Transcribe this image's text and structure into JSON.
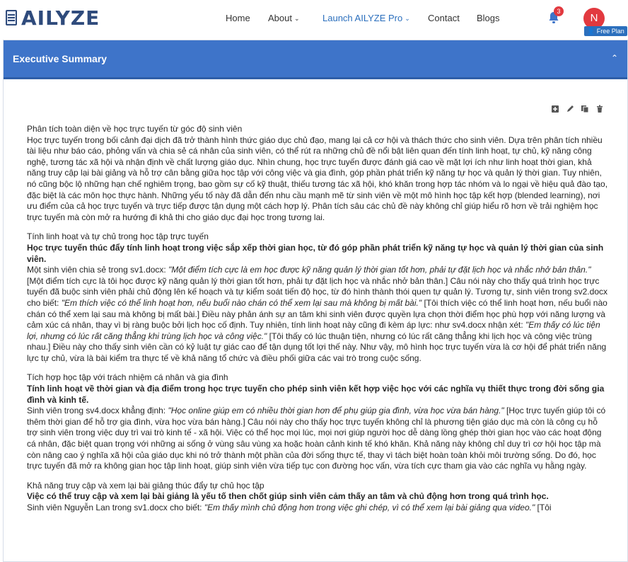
{
  "brand": {
    "name": "AILYZE"
  },
  "nav": {
    "home": "Home",
    "about": "About",
    "launch": "Launch AILYZE Pro",
    "contact": "Contact",
    "blogs": "Blogs"
  },
  "notifications": {
    "count": "3"
  },
  "user": {
    "initial": "N",
    "plan": "Free Plan"
  },
  "panel": {
    "title": "Executive Summary"
  },
  "sections": [
    {
      "heading": "Phân tích toàn diện về học trực tuyến từ góc độ sinh viên",
      "body": "Học trực tuyến trong bối cảnh đại dịch đã trở thành hình thức giáo dục chủ đạo, mang lại cả cơ hội và thách thức cho sinh viên. Dựa trên phân tích nhiều tài liệu như báo cáo, phỏng vấn và chia sẻ cá nhân của sinh viên, có thể rút ra những chủ đề nổi bật liên quan đến tính linh hoạt, tự chủ, kỹ năng công nghệ, tương tác xã hội và nhận định về chất lượng giáo dục. Nhìn chung, học trực tuyến được đánh giá cao về mặt lợi ích như linh hoạt thời gian, khả năng truy cập lại bài giảng và hỗ trợ cân bằng giữa học tập với công việc và gia đình, góp phần phát triển kỹ năng tự học và quản lý thời gian. Tuy nhiên, nó cũng bộc lộ những hạn chế nghiêm trọng, bao gồm sự cố kỹ thuật, thiếu tương tác xã hội, khó khăn trong hợp tác nhóm và lo ngại về hiệu quả đào tạo, đặc biệt là các môn học thực hành. Những yếu tố này đã dẫn đến nhu cầu mạnh mẽ từ sinh viên về một mô hình học tập kết hợp (blended learning), nơi ưu điểm của cả học trực tuyến và trực tiếp được tận dụng một cách hợp lý. Phân tích sâu các chủ đề này không chỉ giúp hiểu rõ hơn về trải nghiệm học trực tuyến mà còn mở ra hướng đi khả thi cho giáo dục đại học trong tương lai."
    },
    {
      "heading": "Tính linh hoạt và tự chủ trong học tập trực tuyến",
      "bold": "Học trực tuyến thúc đẩy tính linh hoạt trong việc sắp xếp thời gian học, từ đó góp phần phát triển kỹ năng tự học và quản lý thời gian của sinh viên.",
      "t1": "Một sinh viên chia sẻ trong sv1.docx: ",
      "q1": "\"Một điểm tích cực là em học được kỹ năng quản lý thời gian tốt hơn, phải tự đặt lịch học và nhắc nhở bản thân.\"",
      "t2": " [Một điểm tích cực là tôi học được kỹ năng quản lý thời gian tốt hơn, phải tự đặt lịch học và nhắc nhở bản thân.] Câu nói này cho thấy quá trình học trực tuyến đã buộc sinh viên phải chủ động lên kế hoạch và tự kiểm soát tiến độ học, từ đó hình thành thói quen tự quản lý. Tương tự, sinh viên trong sv2.docx cho biết: ",
      "q2": "\"Em thích việc có thể linh hoạt hơn, nếu buổi nào chán có thể xem lại sau mà không bị mất bài.\"",
      "t3": " [Tôi thích việc có thể linh hoạt hơn, nếu buổi nào chán có thể xem lại sau mà không bị mất bài.] Điều này phản ánh sự an tâm khi sinh viên được quyền lựa chọn thời điểm học phù hợp với năng lượng và cảm xúc cá nhân, thay vì bị ràng buộc bởi lịch học cố định. Tuy nhiên, tính linh hoạt này cũng đi kèm áp lực: như sv4.docx nhận xét: ",
      "q3": "\"Em thấy có lúc tiện lợi, nhưng có lúc rất căng thẳng khi trùng lịch học và công việc.\"",
      "t4": " [Tôi thấy có lúc thuận tiện, nhưng có lúc rất căng thẳng khi lịch học và công việc trùng nhau.] Điều này cho thấy sinh viên cần có kỷ luật tự giác cao để tận dụng tốt lợi thế này. Như vậy, mô hình học trực tuyến vừa là cơ hội để phát triển năng lực tự chủ, vừa là bài kiểm tra thực tế về khả năng tổ chức và điều phối giữa các vai trò trong cuộc sống."
    },
    {
      "heading": "Tích hợp học tập với trách nhiệm cá nhân và gia đình",
      "bold": "Tính linh hoạt về thời gian và địa điểm trong học trực tuyến cho phép sinh viên kết hợp việc học với các nghĩa vụ thiết thực trong đời sống gia đình và kinh tế.",
      "t1": "Sinh viên trong sv4.docx khẳng định: ",
      "q1": "\"Học online giúp em có nhiều thời gian hơn để phụ giúp gia đình, vừa học vừa bán hàng.\"",
      "t2": " [Học trực tuyến giúp tôi có thêm thời gian để hỗ trợ gia đình, vừa học vừa bán hàng.] Câu nói này cho thấy học trực tuyến không chỉ là phương tiện giáo dục mà còn là công cụ hỗ trợ sinh viên trong việc duy trì vai trò kinh tế - xã hội. Việc có thể học mọi lúc, mọi nơi giúp người học dễ dàng lồng ghép thời gian học vào các hoạt động cá nhân, đặc biệt quan trọng với những ai sống ở vùng sâu vùng xa hoặc hoàn cảnh kinh tế khó khăn. Khả năng này không chỉ duy trì cơ hội học tập mà còn nâng cao ý nghĩa xã hội của giáo dục khi nó trở thành một phần của đời sống thực tế, thay vì tách biệt hoàn toàn khỏi môi trường sống. Do đó, học trực tuyến đã mở ra không gian học tập linh hoạt, giúp sinh viên vừa tiếp tục con đường học vấn, vừa tích cực tham gia vào các nghĩa vụ hằng ngày."
    },
    {
      "heading": "Khả năng truy cập và xem lại bài giảng thúc đẩy tự chủ học tập",
      "bold": "Việc có thể truy cập và xem lại bài giảng là yếu tố then chốt giúp sinh viên cảm thấy an tâm và chủ động hơn trong quá trình học.",
      "t1": "Sinh viên Nguyễn Lan trong sv1.docx cho biết: ",
      "q1": "\"Em thấy mình chủ động hơn trong việc ghi chép, vì có thể xem lại bài giảng qua video.\"",
      "t2": " [Tôi"
    }
  ]
}
